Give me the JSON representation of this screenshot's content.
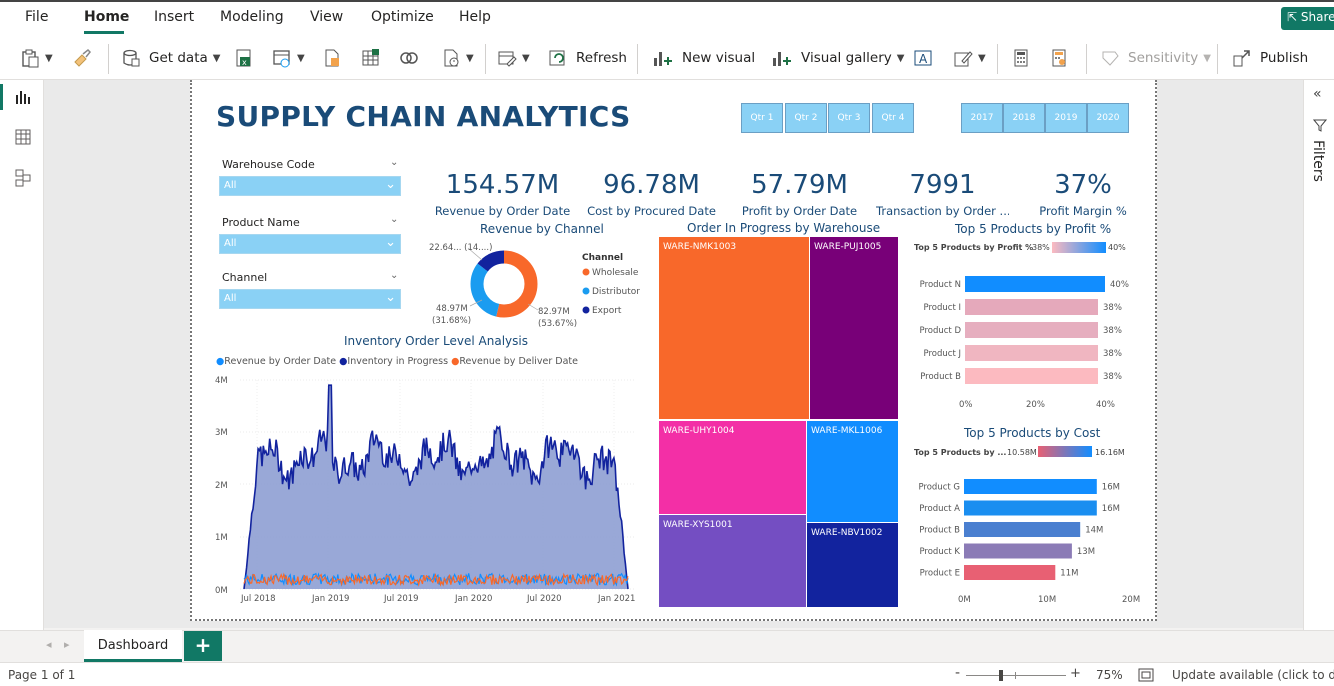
{
  "menu": {
    "items": [
      "File",
      "Home",
      "Insert",
      "Modeling",
      "View",
      "Optimize",
      "Help"
    ],
    "share": "Share"
  },
  "ribbon": {
    "get_data": "Get data",
    "refresh": "Refresh",
    "new_visual": "New visual",
    "visual_gallery": "Visual gallery",
    "sensitivity": "Sensitivity",
    "publish": "Publish"
  },
  "right_pane": {
    "filters": "Filters"
  },
  "report": {
    "title": "SUPPLY CHAIN ANALYTICS",
    "quarters": [
      "Qtr 1",
      "Qtr 2",
      "Qtr 3",
      "Qtr 4"
    ],
    "years": [
      "2017",
      "2018",
      "2019",
      "2020"
    ],
    "slicers": [
      {
        "title": "Warehouse Code",
        "value": "All"
      },
      {
        "title": "Product Name",
        "value": "All"
      },
      {
        "title": "Channel",
        "value": "All"
      }
    ],
    "kpis": [
      {
        "value": "154.57M",
        "label": "Revenue by Order Date"
      },
      {
        "value": "96.78M",
        "label": "Cost by Procured Date"
      },
      {
        "value": "57.79M",
        "label": "Profit by Order Date"
      },
      {
        "value": "7991",
        "label": "Transaction by Order ..."
      },
      {
        "value": "37%",
        "label": "Profit Margin %"
      }
    ],
    "donut": {
      "title": "Revenue by Channel",
      "legend_title": "Channel",
      "items": [
        {
          "name": "Wholesale",
          "color": "#f8682a"
        },
        {
          "name": "Distributor",
          "color": "#1a9cf0"
        },
        {
          "name": "Export",
          "color": "#12239e"
        }
      ],
      "label_top": "22.64... (14....)",
      "label_left_1": "48.97M",
      "label_left_2": "(31.68%)",
      "label_right_1": "82.97M",
      "label_right_2": "(53.67%)"
    },
    "treemap": {
      "title": "Order In Progress by Warehouse",
      "cells": [
        "WARE-NMK1003",
        "WARE-PUJ1005",
        "WARE-UHY1004",
        "WARE-MKL1006",
        "WARE-XYS1001",
        "WARE-NBV1002"
      ]
    },
    "profit": {
      "title": "Top 5 Products by Profit %",
      "legend_label": "Top 5 Products by Profit %",
      "legend_min": "38%",
      "legend_max": "40%",
      "x_ticks": [
        "0%",
        "20%",
        "40%"
      ]
    },
    "cost": {
      "title": "Top 5 Products by Cost",
      "legend_label": "Top 5 Products by ...",
      "legend_min": "10.58M",
      "legend_max": "16.16M",
      "x_ticks": [
        "0M",
        "10M",
        "20M"
      ]
    },
    "area": {
      "title": "Inventory Order Level Analysis",
      "legend": [
        "Revenue by Order Date",
        "Inventory in Progress",
        "Revenue by Deliver Date"
      ],
      "y_ticks": [
        "4M",
        "3M",
        "2M",
        "1M",
        "0M"
      ],
      "x_ticks": [
        "Jul 2018",
        "Jan 2019",
        "Jul 2019",
        "Jan 2020",
        "Jul 2020",
        "Jan 2021"
      ]
    }
  },
  "tabs": {
    "dashboard": "Dashboard",
    "add": "+"
  },
  "status": {
    "page": "Page 1 of 1",
    "zoom": "75%",
    "update": "Update available (click to download)"
  },
  "chart_data": [
    {
      "type": "pie",
      "title": "Revenue by Channel",
      "categories": [
        "Wholesale",
        "Distributor",
        "Export"
      ],
      "values": [
        82.97,
        48.97,
        22.64
      ],
      "percent": [
        53.67,
        31.68,
        14.65
      ],
      "unit": "M"
    },
    {
      "type": "bar",
      "title": "Top 5 Products by Profit %",
      "categories": [
        "Product N",
        "Product I",
        "Product D",
        "Product J",
        "Product B"
      ],
      "values": [
        40,
        38,
        38,
        38,
        38
      ],
      "labels": [
        "40%",
        "38%",
        "38%",
        "38%",
        "38%"
      ],
      "colors": [
        "#118dff",
        "#e5a9bb",
        "#e6aebf",
        "#f0b6c1",
        "#fcbac0"
      ],
      "xlim": [
        0,
        40
      ]
    },
    {
      "type": "bar",
      "title": "Top 5 Products by Cost",
      "categories": [
        "Product G",
        "Product A",
        "Product B",
        "Product K",
        "Product E"
      ],
      "values": [
        16,
        16,
        14,
        13,
        11
      ],
      "labels": [
        "16M",
        "16M",
        "14M",
        "13M",
        "11M"
      ],
      "colors": [
        "#118dff",
        "#1a8ef0",
        "#4a7fd0",
        "#8b7bb6",
        "#e86073"
      ],
      "xlim": [
        0,
        20
      ]
    },
    {
      "type": "area",
      "title": "Inventory Order Level Analysis",
      "series": [
        {
          "name": "Revenue by Order Date"
        },
        {
          "name": "Inventory in Progress"
        },
        {
          "name": "Revenue by Deliver Date"
        }
      ],
      "ylim": [
        0,
        4000000
      ]
    }
  ]
}
